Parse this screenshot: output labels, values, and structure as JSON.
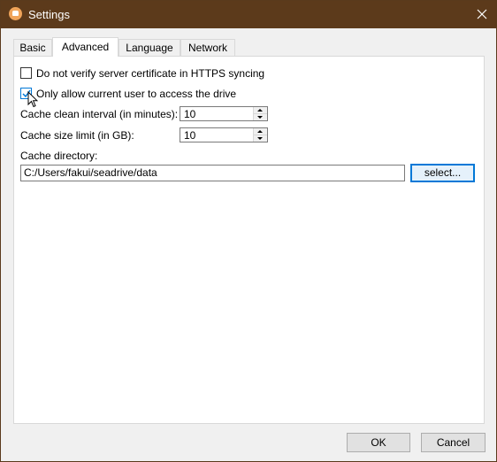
{
  "window": {
    "title": "Settings"
  },
  "icons": {
    "app": "seadrive-app-icon",
    "close": "close-icon",
    "cursor": "pointer-cursor-icon"
  },
  "colors": {
    "titlebar": "#5c3a1b",
    "accent": "#0078d7",
    "panel": "#ffffff",
    "window_bg": "#f0f0f0"
  },
  "tabs": [
    {
      "label": "Basic",
      "active": false
    },
    {
      "label": "Advanced",
      "active": true
    },
    {
      "label": "Language",
      "active": false
    },
    {
      "label": "Network",
      "active": false
    }
  ],
  "advanced": {
    "verify_cert": {
      "label": "Do not verify server certificate in HTTPS syncing",
      "checked": false
    },
    "current_user_only": {
      "label": "Only allow current user to access the drive",
      "checked": true
    },
    "cache_clean_interval": {
      "label": "Cache clean interval (in minutes):",
      "value": "10"
    },
    "cache_size_limit": {
      "label": "Cache size limit (in GB):",
      "value": "10"
    },
    "cache_directory": {
      "label": "Cache directory:",
      "value": "C:/Users/fakui/seadrive/data",
      "select_label": "select..."
    }
  },
  "footer": {
    "ok_label": "OK",
    "cancel_label": "Cancel"
  }
}
